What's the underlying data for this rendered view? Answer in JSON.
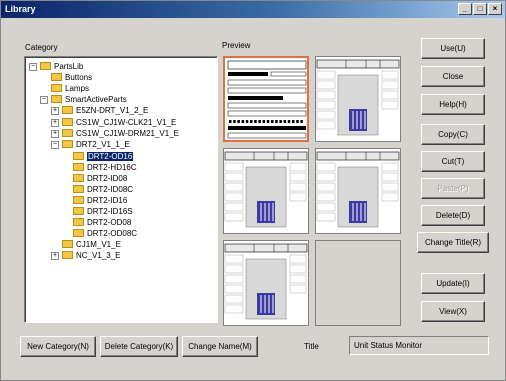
{
  "window": {
    "title": "Library",
    "min_icon": "_",
    "max_icon": "□",
    "close_icon": "×"
  },
  "category_label": "Category",
  "preview_label": "Preview",
  "tree": [
    {
      "label": "PartsLib",
      "expander": "−"
    },
    {
      "label": "Buttons"
    },
    {
      "label": "Lamps"
    },
    {
      "label": "SmartActiveParts",
      "expander": "−"
    },
    {
      "label": "E5ZN-DRT_V1_2_E",
      "expander": "+"
    },
    {
      "label": "CS1W_CJ1W-CLK21_V1_E",
      "expander": "+"
    },
    {
      "label": "CS1W_CJ1W-DRM21_V1_E",
      "expander": "+"
    },
    {
      "label": "DRT2_V1_1_E",
      "expander": "−"
    },
    {
      "label": "DRT2-OD16"
    },
    {
      "label": "DRT2-HD16C"
    },
    {
      "label": "DRT2-ID08"
    },
    {
      "label": "DRT2-ID08C"
    },
    {
      "label": "DRT2-ID16"
    },
    {
      "label": "DRT2-ID16S"
    },
    {
      "label": "DRT2-OD08"
    },
    {
      "label": "DRT2-OD08C"
    },
    {
      "label": "CJ1M_V1_E"
    },
    {
      "label": "NC_V1_3_E",
      "expander": "+"
    }
  ],
  "buttons": {
    "use": "Use(U)",
    "close": "Close",
    "help": "Help(H)",
    "copy": "Copy(C)",
    "cut": "Cut(T)",
    "paste": "Paste(P)",
    "delete": "Delete(D)",
    "change_title": "Change Title(R)",
    "update": "Update(I)",
    "view": "View(X)",
    "new_category": "New Category(N)",
    "delete_category": "Delete Category(K)",
    "change_name": "Change Name(M)"
  },
  "title_label": "Title",
  "title_value": "Unit Status Monitor",
  "colors": {
    "selection": "#0a246a",
    "active_thumb_border": "#e07040",
    "folder": "#f2c744",
    "face": "#d6d3ce"
  }
}
